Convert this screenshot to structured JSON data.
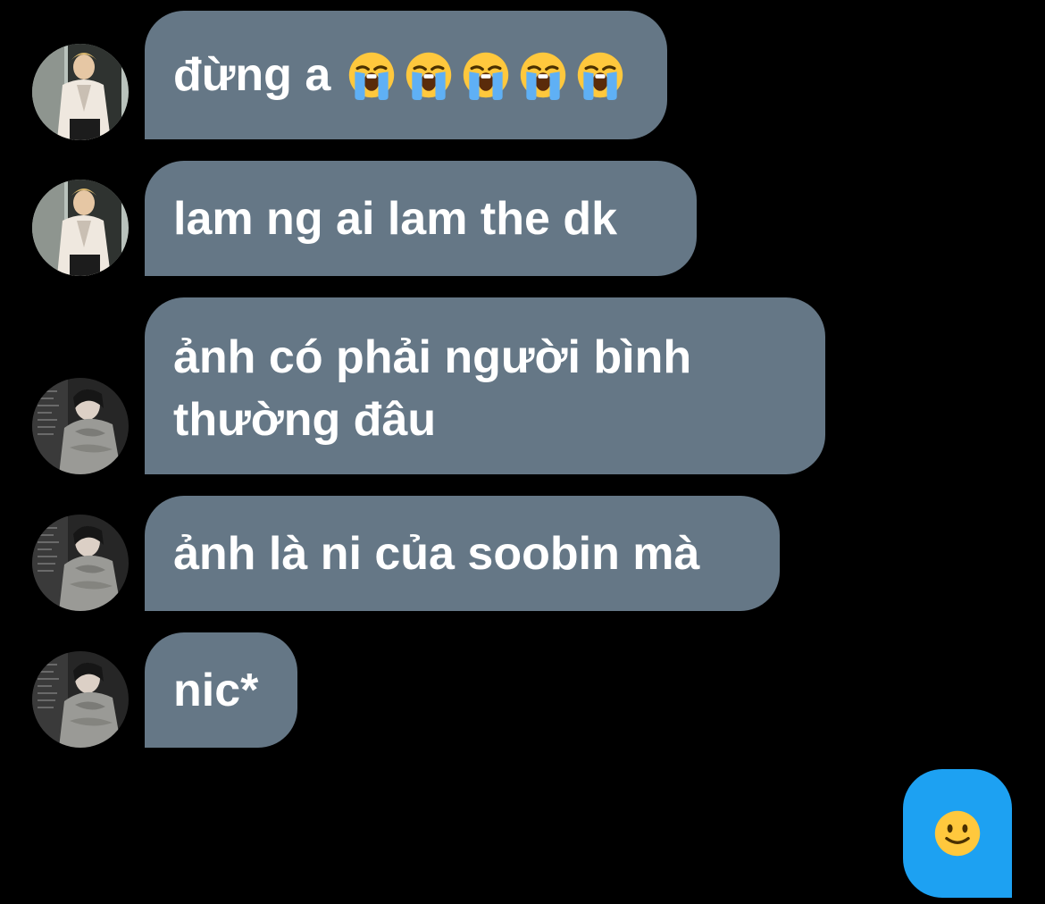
{
  "conversation": {
    "messages": [
      {
        "text": "đừng a",
        "emoji": [
          "loudly-crying-face",
          "loudly-crying-face",
          "loudly-crying-face",
          "loudly-crying-face",
          "loudly-crying-face"
        ]
      },
      {
        "text": "lam ng ai lam the dk"
      },
      {
        "text": "ảnh có phải người bình thường đâu"
      },
      {
        "text": "ảnh là ni của soobin mà"
      },
      {
        "text": "nic*"
      }
    ],
    "outgoing": {
      "emoji": "slightly-smiling-face"
    }
  },
  "colors": {
    "background": "#000000",
    "incoming_bubble": "#657786",
    "outgoing_bubble": "#1DA1F2",
    "text": "#FFFFFF"
  }
}
